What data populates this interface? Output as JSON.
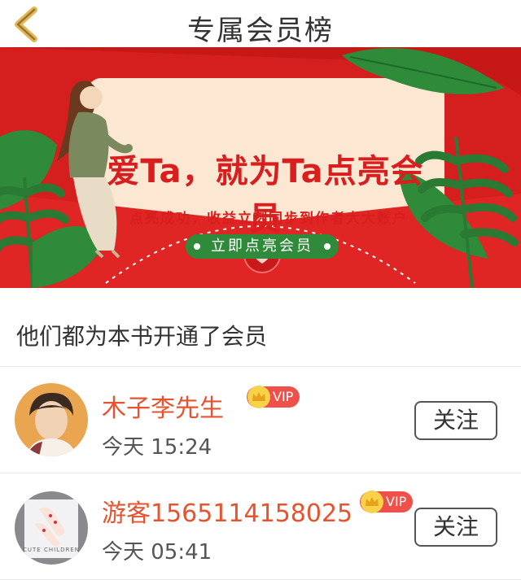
{
  "header": {
    "title": "专属会员榜",
    "back_icon": "chevron-left-icon"
  },
  "banner": {
    "headline": "爱Ta，就为Ta点亮会员",
    "subtext": "点亮成功，收益立刻同步到作者大大账户",
    "button_label": "立即点亮会员",
    "colors": {
      "primary_red": "#d81e1e",
      "card": "#fce8d2",
      "button_green": "#2f8a3a"
    }
  },
  "section": {
    "title": "他们都为本书开通了会员"
  },
  "members": [
    {
      "name": "木子李先生",
      "badge": "VIP",
      "time": "今天 15:24",
      "follow_label": "关注"
    },
    {
      "name": "游客1565114158025",
      "badge": "VIP",
      "time": "今天 05:41",
      "follow_label": "关注",
      "avatar_caption": "CUTE CHILDREN"
    }
  ],
  "colors": {
    "name": "#e6532e",
    "vip_badge": "#f0504a",
    "back_chevron": "#e8b64a"
  }
}
